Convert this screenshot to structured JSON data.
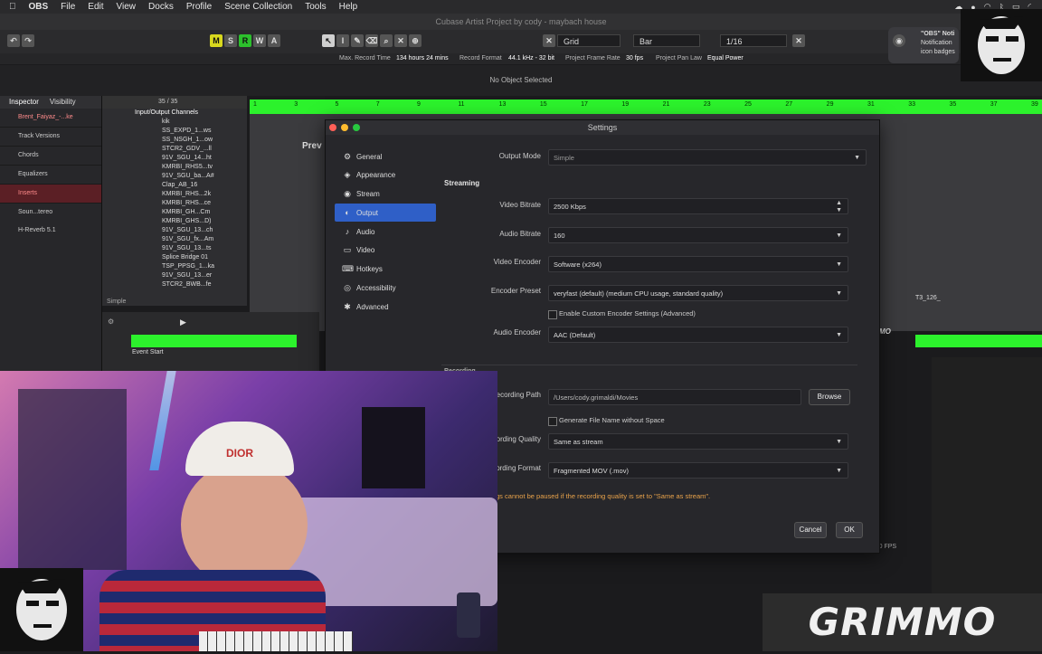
{
  "menubar": {
    "app": "OBS",
    "items": [
      "File",
      "Edit",
      "View",
      "Docks",
      "Profile",
      "Scene Collection",
      "Tools",
      "Help"
    ]
  },
  "cubase": {
    "window_title": "Cubase Artist Project by cody - maybach house",
    "toolbar": {
      "mode_buttons": [
        "M",
        "S",
        "R",
        "W",
        "A"
      ],
      "snap_label": "Grid",
      "grid_type": "Bar",
      "quantize": "1/16"
    },
    "infobar": {
      "max_record_time_label": "Max. Record Time",
      "max_record_time_value": "134 hours 24 mins",
      "record_format_label": "Record Format",
      "record_format_value": "44.1 kHz - 32 bit",
      "frame_rate_label": "Project Frame Rate",
      "frame_rate_value": "30 fps",
      "pan_law_label": "Project Pan Law",
      "pan_law_value": "Equal Power"
    },
    "status": "No Object Selected",
    "inspector": {
      "tabs": [
        "Inspector",
        "Visibility"
      ],
      "track_name": "Brent_Faiyaz_-...ke",
      "sections": [
        "Track Versions",
        "Chords",
        "Equalizers",
        "Inserts"
      ],
      "inserts": [
        "Soun...tereo",
        "H-Reverb 5.1"
      ]
    },
    "track_count": "35 / 35",
    "folder": "Input/Output Channels",
    "tracks": [
      "kik",
      "SS_EXPD_1...ws",
      "SS_NSGH_1...ow",
      "STCR2_GDV_...ll",
      "91V_SGU_14...ht",
      "KMRBI_RHS5...tv",
      "91V_SGU_ba...A#",
      "Clap_AB_16",
      "KMRBI_RHS...2k",
      "KMRBI_RHS...ce",
      "KMRBI_GH...Cm",
      "KMRBI_GHS...D)",
      "91V_SGU_13...ch",
      "91V_SGU_fx...Am",
      "91V_SGU_13...ts",
      "Splice Bridge 01",
      "TSP_PPSG_1...ka",
      "91V_SGU_13...er",
      "STCR2_BWB...fe"
    ],
    "bottom_left": "Simple",
    "ruler_ticks": [
      "1",
      "3",
      "5",
      "7",
      "9",
      "11",
      "13",
      "15",
      "17",
      "19",
      "21",
      "23",
      "25",
      "27",
      "29",
      "31",
      "33",
      "35",
      "37",
      "39"
    ],
    "event_start": "Event Start",
    "side_partial": "Prev",
    "right_clip": "T3_126_",
    "right_mo": "MO",
    "fps": "60.00 FPS"
  },
  "notification": {
    "title": "\"OBS\" Noti",
    "line1": "Notification",
    "line2": "icon badges"
  },
  "settings": {
    "title": "Settings",
    "nav": [
      {
        "label": "General",
        "icon": "⚙"
      },
      {
        "label": "Appearance",
        "icon": "◈"
      },
      {
        "label": "Stream",
        "icon": "◉"
      },
      {
        "label": "Output",
        "icon": "◐"
      },
      {
        "label": "Audio",
        "icon": "♪"
      },
      {
        "label": "Video",
        "icon": "▭"
      },
      {
        "label": "Hotkeys",
        "icon": "⌨"
      },
      {
        "label": "Accessibility",
        "icon": "◎"
      },
      {
        "label": "Advanced",
        "icon": "✱"
      }
    ],
    "selected_nav": "Output",
    "output_mode_label": "Output Mode",
    "output_mode_value": "Simple",
    "streaming_title": "Streaming",
    "video_bitrate_label": "Video Bitrate",
    "video_bitrate_value": "2500 Kbps",
    "audio_bitrate_label": "Audio Bitrate",
    "audio_bitrate_value": "160",
    "video_encoder_label": "Video Encoder",
    "video_encoder_value": "Software (x264)",
    "encoder_preset_label": "Encoder Preset",
    "encoder_preset_value": "veryfast (default) (medium CPU usage, standard quality)",
    "custom_encoder_label": "Enable Custom Encoder Settings (Advanced)",
    "audio_encoder_label": "Audio Encoder",
    "audio_encoder_value": "AAC (Default)",
    "recording_title": "Recording",
    "recording_path_label": "Recording Path",
    "recording_path_value": "/Users/cody.grimaldi/Movies",
    "browse_label": "Browse",
    "gen_filename_label": "Generate File Name without Space",
    "recording_quality_label": "Recording Quality",
    "recording_quality_value": "Same as stream",
    "recording_format_label": "Recording Format",
    "recording_format_value": "Fragmented MOV (.mov)",
    "warning": "Recordings cannot be paused if the recording quality is set to \"Same as stream\".",
    "cancel_label": "Cancel",
    "ok_label": "OK"
  },
  "webcam": {
    "hat_text": "DIOR"
  },
  "branding": {
    "name": "GRIMMO"
  },
  "colors": {
    "accent_green": "#2cf22c",
    "selection_blue": "#2f5fc7",
    "warning_orange": "#e8a24a"
  }
}
